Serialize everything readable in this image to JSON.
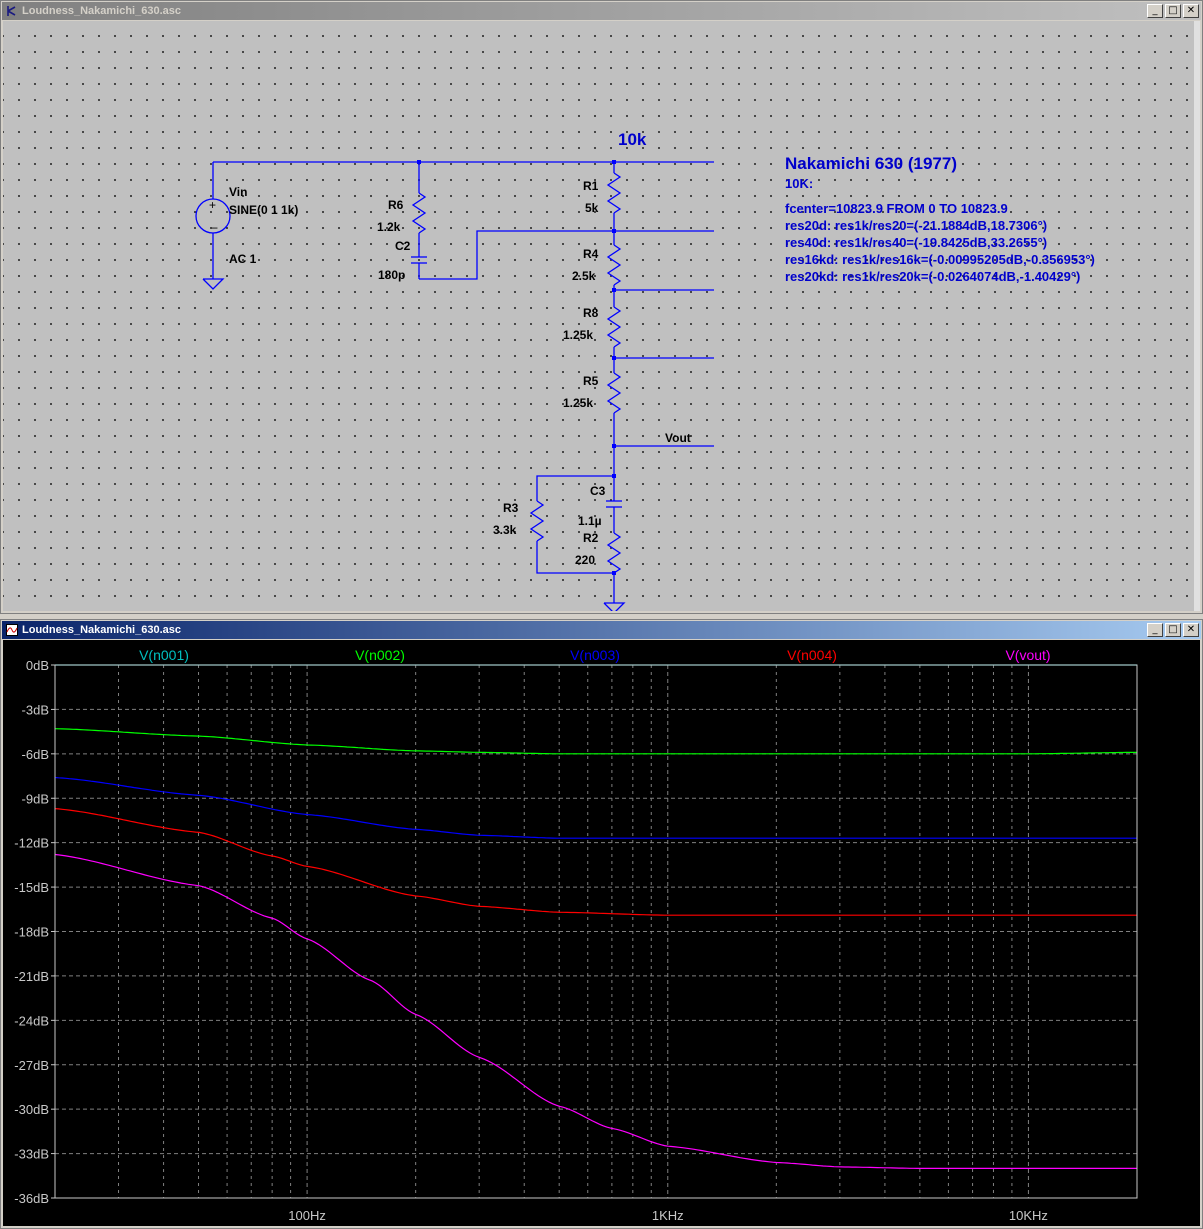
{
  "schematic_window": {
    "title": "Loudness_Nakamichi_630.asc",
    "buttons": {
      "minimize": "_",
      "maximize": "□",
      "close": "✕"
    }
  },
  "plot_window": {
    "title": "Loudness_Nakamichi_630.asc",
    "buttons": {
      "minimize": "_",
      "maximize": "□",
      "close": "✕"
    }
  },
  "schematic": {
    "source": {
      "name": "Vin",
      "value": "SINE(0 1 1k)",
      "ac": "AC 1"
    },
    "components": [
      {
        "ref": "R6",
        "value": "1.2k"
      },
      {
        "ref": "C2",
        "value": "180p"
      },
      {
        "ref": "R1",
        "value": "5k"
      },
      {
        "ref": "R4",
        "value": "2.5k"
      },
      {
        "ref": "R8",
        "value": "1.25k"
      },
      {
        "ref": "R5",
        "value": "1.25k"
      },
      {
        "ref": "C3",
        "value": "1.1µ"
      },
      {
        "ref": "R2",
        "value": "220"
      },
      {
        "ref": "R3",
        "value": "3.3k"
      }
    ],
    "net_labels": {
      "top": "10k",
      "out": "Vout"
    },
    "annotation": {
      "title": "Nakamichi 630 (1977)",
      "subtitle": "10K:",
      "lines": [
        "fcenter=10823.9 FROM 0 TO 10823.9",
        "res20d: res1k/res20=(-21.1884dB,18.7306°)",
        "res40d: res1k/res40=(-19.8425dB,33.2655°)",
        "res16kd: res1k/res16k=(-0.00995205dB,-0.356953°)",
        "res20kd: res1k/res20k=(-0.0264074dB,-1.40429°)"
      ]
    },
    "colors": {
      "wire": "#0000ff",
      "text": "#000000",
      "annotation": "#0000cc"
    }
  },
  "chart_data": {
    "type": "line",
    "xscale": "log",
    "xlim": [
      20,
      20000
    ],
    "ylim": [
      -36,
      0
    ],
    "x_tick_labels": [
      {
        "x": 100,
        "label": "100Hz"
      },
      {
        "x": 1000,
        "label": "1KHz"
      },
      {
        "x": 10000,
        "label": "10KHz"
      }
    ],
    "y_ticks": [
      0,
      -3,
      -6,
      -9,
      -12,
      -15,
      -18,
      -21,
      -24,
      -27,
      -30,
      -33,
      -36
    ],
    "y_tick_labels": [
      "0dB",
      "-3dB",
      "-6dB",
      "-9dB",
      "-12dB",
      "-15dB",
      "-18dB",
      "-21dB",
      "-24dB",
      "-27dB",
      "-30dB",
      "-33dB",
      "-36dB"
    ],
    "grid": true,
    "legend": "top",
    "series": [
      {
        "name": "V(n001)",
        "color": "#00c0c0",
        "x": [
          20,
          20000
        ],
        "y": [
          0,
          0
        ]
      },
      {
        "name": "V(n002)",
        "color": "#00ff00",
        "x": [
          20,
          50,
          100,
          200,
          300,
          500,
          1000,
          2000,
          5000,
          10000,
          20000
        ],
        "y": [
          -4.3,
          -4.8,
          -5.4,
          -5.8,
          -5.9,
          -6.0,
          -6.0,
          -6.0,
          -6.0,
          -6.0,
          -5.9
        ]
      },
      {
        "name": "V(n003)",
        "color": "#0000ff",
        "x": [
          20,
          50,
          100,
          200,
          300,
          500,
          1000,
          2000,
          5000,
          10000,
          20000
        ],
        "y": [
          -7.6,
          -8.8,
          -10.1,
          -11.1,
          -11.5,
          -11.7,
          -11.7,
          -11.7,
          -11.7,
          -11.7,
          -11.7
        ]
      },
      {
        "name": "V(n004)",
        "color": "#ff0000",
        "x": [
          20,
          50,
          80,
          100,
          200,
          300,
          500,
          1000,
          2000,
          5000,
          10000,
          20000
        ],
        "y": [
          -9.7,
          -11.3,
          -12.9,
          -13.6,
          -15.6,
          -16.3,
          -16.7,
          -16.9,
          -16.9,
          -16.9,
          -16.9,
          -16.9
        ]
      },
      {
        "name": "V(vout)",
        "color": "#ff00ff",
        "x": [
          20,
          50,
          80,
          100,
          150,
          200,
          300,
          500,
          700,
          1000,
          2000,
          3000,
          5000,
          10000,
          20000
        ],
        "y": [
          -12.8,
          -14.9,
          -17.1,
          -18.5,
          -21.3,
          -23.6,
          -26.5,
          -29.8,
          -31.3,
          -32.5,
          -33.6,
          -33.9,
          -34.0,
          -34.0,
          -34.0
        ]
      }
    ]
  }
}
